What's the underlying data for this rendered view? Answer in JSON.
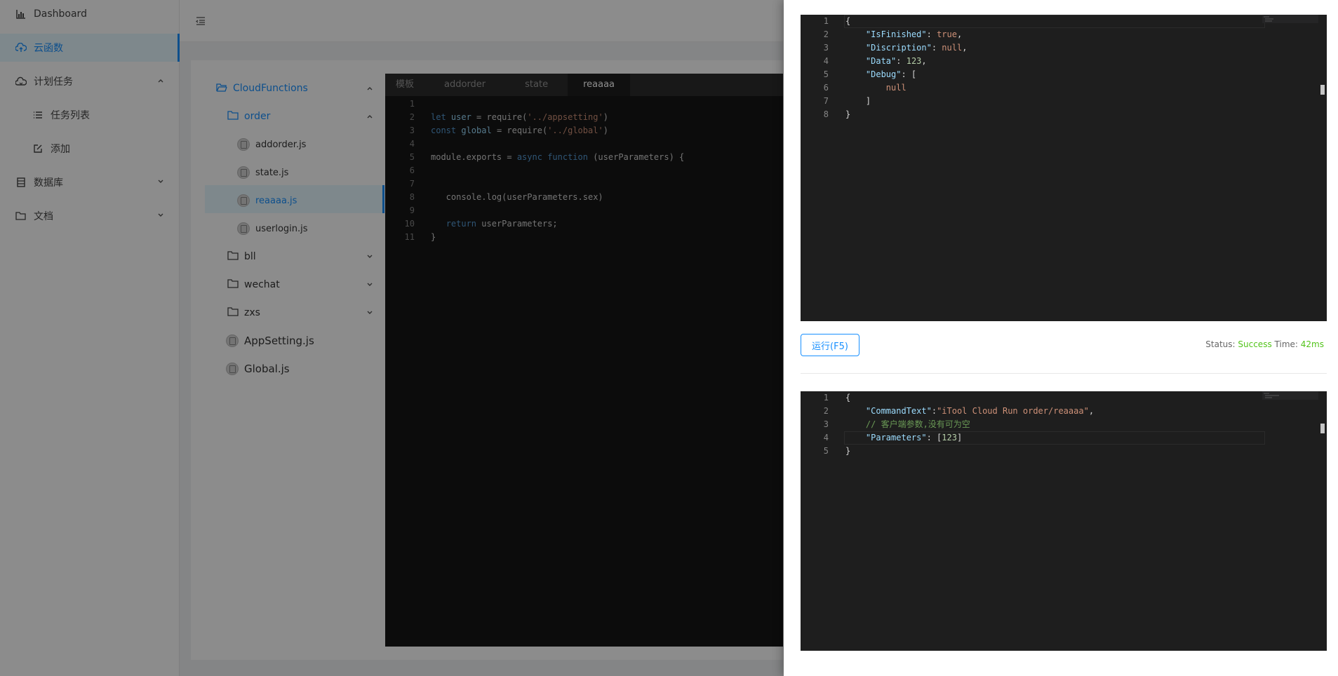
{
  "sidebar": {
    "items": [
      {
        "label": "Dashboard",
        "icon": "chart-icon"
      },
      {
        "label": "云函数",
        "icon": "cloud-upload-icon"
      },
      {
        "label": "计划任务",
        "icon": "cloud-icon"
      },
      {
        "label": "任务列表",
        "icon": "list-icon"
      },
      {
        "label": "添加",
        "icon": "edit-icon"
      },
      {
        "label": "数据库",
        "icon": "database-icon"
      },
      {
        "label": "文档",
        "icon": "folder-icon"
      }
    ]
  },
  "tree": {
    "root": "CloudFunctions",
    "folder_order": "order",
    "files_order": [
      "addorder.js",
      "state.js",
      "reaaaa.js",
      "userlogin.js"
    ],
    "folders": [
      "bll",
      "wechat",
      "zxs"
    ],
    "root_files": [
      "AppSetting.js",
      "Global.js"
    ]
  },
  "editor": {
    "tabs": [
      "模板",
      "addorder",
      "state",
      "reaaaa"
    ],
    "active_tab": "reaaaa",
    "line_numbers": [
      "1",
      "2",
      "3",
      "4",
      "5",
      "6",
      "7",
      "8",
      "9",
      "10",
      "11"
    ]
  },
  "result_panel": {
    "line_numbers": [
      "1",
      "2",
      "3",
      "4",
      "5",
      "6",
      "7",
      "8"
    ]
  },
  "run": {
    "button_label": "运行(F5)",
    "status_prefix": "Status:",
    "status_value": "Success",
    "time_prefix": "Time:",
    "time_value": "42ms"
  },
  "request_panel": {
    "line_numbers": [
      "1",
      "2",
      "3",
      "4",
      "5"
    ]
  },
  "colors": {
    "accent": "#1890ff",
    "success": "#52c41a",
    "editor_bg": "#1e1e1e"
  }
}
